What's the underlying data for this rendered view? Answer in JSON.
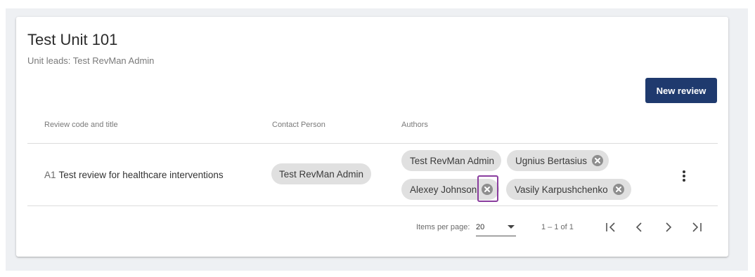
{
  "unit": {
    "title": "Test Unit 101",
    "leads": "Unit leads: Test RevMan Admin"
  },
  "toolbar": {
    "new_review_label": "New review"
  },
  "table": {
    "headers": {
      "review": "Review code and title",
      "contact": "Contact Person",
      "authors": "Authors"
    },
    "rows": [
      {
        "code": "A1",
        "title": "Test review for healthcare interventions",
        "contact": "Test RevMan Admin",
        "authors": [
          {
            "name": "Test RevMan Admin",
            "removable": false
          },
          {
            "name": "Ugnius Bertasius",
            "removable": true
          },
          {
            "name": "Alexey Johnson",
            "removable": true
          },
          {
            "name": "Vasily Karpushchenko",
            "removable": true
          }
        ]
      }
    ]
  },
  "paginator": {
    "items_per_page_label": "Items per page:",
    "items_per_page_value": "20",
    "range_label": "1 – 1 of 1"
  },
  "icons": {
    "remove": "close-circle-icon",
    "menu": "more-vert-icon",
    "first": "first-page-icon",
    "prev": "chevron-left-icon",
    "next": "chevron-right-icon",
    "last": "last-page-icon"
  },
  "colors": {
    "primary": "#1f3a6e",
    "chip_bg": "#e0e0e0",
    "focus_outline": "#8a3d9e"
  }
}
